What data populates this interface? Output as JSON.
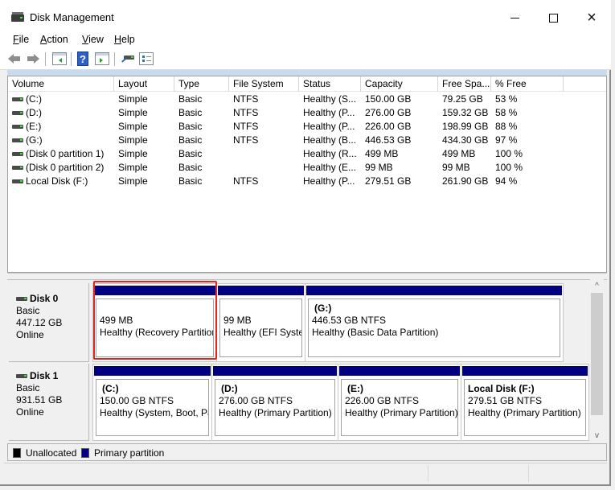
{
  "window": {
    "title": "Disk Management",
    "controls": {
      "minimize": "minimize",
      "maximize": "maximize",
      "close": "×"
    }
  },
  "menu": [
    {
      "label": "File",
      "accel": "F"
    },
    {
      "label": "Action",
      "accel": "A"
    },
    {
      "label": "View",
      "accel": "V"
    },
    {
      "label": "Help",
      "accel": "H"
    }
  ],
  "toolbar": {
    "buttons": [
      "back-icon",
      "forward-icon",
      "show-hide-console-tree-icon",
      "help-icon",
      "show-hide-action-pane-icon",
      "rescan-disks-icon",
      "properties-icon"
    ],
    "help_glyph": "?"
  },
  "volume_list": {
    "columns": [
      "Volume",
      "Layout",
      "Type",
      "File System",
      "Status",
      "Capacity",
      "Free Spa...",
      "% Free"
    ],
    "rows": [
      {
        "volume": " (C:)",
        "layout": "Simple",
        "type": "Basic",
        "fs": "NTFS",
        "status": "Healthy (S...",
        "capacity": "150.00 GB",
        "free": "79.25 GB",
        "pct": "53 %"
      },
      {
        "volume": " (D:)",
        "layout": "Simple",
        "type": "Basic",
        "fs": "NTFS",
        "status": "Healthy (P...",
        "capacity": "276.00 GB",
        "free": "159.32 GB",
        "pct": "58 %"
      },
      {
        "volume": " (E:)",
        "layout": "Simple",
        "type": "Basic",
        "fs": "NTFS",
        "status": "Healthy (P...",
        "capacity": "226.00 GB",
        "free": "198.99 GB",
        "pct": "88 %"
      },
      {
        "volume": " (G:)",
        "layout": "Simple",
        "type": "Basic",
        "fs": "NTFS",
        "status": "Healthy (B...",
        "capacity": "446.53 GB",
        "free": "434.30 GB",
        "pct": "97 %"
      },
      {
        "volume": "(Disk 0 partition 1)",
        "layout": "Simple",
        "type": "Basic",
        "fs": "",
        "status": "Healthy (R...",
        "capacity": "499 MB",
        "free": "499 MB",
        "pct": "100 %"
      },
      {
        "volume": "(Disk 0 partition 2)",
        "layout": "Simple",
        "type": "Basic",
        "fs": "",
        "status": "Healthy (E...",
        "capacity": "99 MB",
        "free": "99 MB",
        "pct": "100 %"
      },
      {
        "volume": "Local Disk (F:)",
        "layout": "Simple",
        "type": "Basic",
        "fs": "NTFS",
        "status": "Healthy (P...",
        "capacity": "279.51 GB",
        "free": "261.90 GB",
        "pct": "94 %"
      }
    ]
  },
  "disks": [
    {
      "name": "Disk 0",
      "type": "Basic",
      "size": "447.12 GB",
      "state": "Online",
      "partitions": [
        {
          "name": "",
          "size_line": "499 MB",
          "status": "Healthy (Recovery Partition)",
          "highlighted": true
        },
        {
          "name": "",
          "size_line": "99 MB",
          "status": "Healthy (EFI System Partition)",
          "highlighted": false
        },
        {
          "name": " (G:)",
          "size_line": "446.53 GB NTFS",
          "status": "Healthy (Basic Data Partition)",
          "highlighted": false
        }
      ]
    },
    {
      "name": "Disk 1",
      "type": "Basic",
      "size": "931.51 GB",
      "state": "Online",
      "partitions": [
        {
          "name": " (C:)",
          "size_line": "150.00 GB NTFS",
          "status": "Healthy (System, Boot, Page File, Active, Crash Dump, Primary Partition)"
        },
        {
          "name": " (D:)",
          "size_line": "276.00 GB NTFS",
          "status": "Healthy (Primary Partition)"
        },
        {
          "name": " (E:)",
          "size_line": "226.00 GB NTFS",
          "status": "Healthy (Primary Partition)"
        },
        {
          "name": "Local Disk  (F:)",
          "size_line": "279.51 GB NTFS",
          "status": "Healthy (Primary Partition)"
        }
      ]
    }
  ],
  "legend": [
    {
      "label": "Unallocated",
      "color": "#000000"
    },
    {
      "label": "Primary partition",
      "color": "#000080"
    }
  ],
  "colors": {
    "partition_bar": "#000080",
    "highlight": "#e8231f"
  },
  "scroll": {
    "up": "^",
    "down": "v"
  }
}
